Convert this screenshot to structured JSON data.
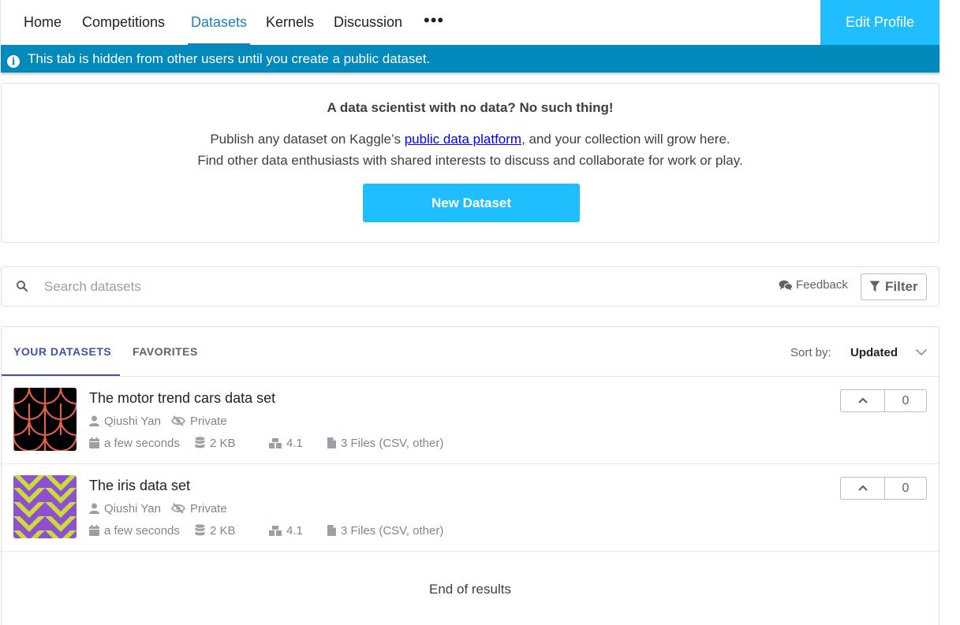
{
  "nav": {
    "tabs": [
      {
        "label": "Home"
      },
      {
        "label": "Competitions"
      },
      {
        "label": "Datasets",
        "active": true
      },
      {
        "label": "Kernels"
      },
      {
        "label": "Discussion"
      }
    ],
    "more_label": "•••",
    "edit_profile": "Edit Profile"
  },
  "banner": {
    "icon": "info-icon",
    "text": "This tab is hidden from other users until you create a public dataset."
  },
  "promo": {
    "title": "A data scientist with no data? No such thing!",
    "line1_before": "Publish any dataset on Kaggle’s ",
    "line1_link": "public data platform",
    "line1_after": ", and your collection will grow here.",
    "line2": "Find other data enthusiasts with shared interests to discuss and collaborate for work or play.",
    "button": "New Dataset"
  },
  "search": {
    "placeholder": "Search datasets",
    "value": "",
    "feedback": "Feedback",
    "filter": "Filter"
  },
  "results": {
    "tabs": {
      "yours": "YOUR DATASETS",
      "favorites": "FAVORITES"
    },
    "sort_label": "Sort by:",
    "sort_value": "Updated",
    "items": [
      {
        "title": "The motor trend cars data set",
        "owner": "Qiushi Yan",
        "visibility": "Private",
        "updated": "a few seconds",
        "size": "2 KB",
        "usability": "4.1",
        "files": "3 Files (CSV, other)",
        "votes": "0",
        "thumb": "scales-pattern"
      },
      {
        "title": "The iris data set",
        "owner": "Qiushi Yan",
        "visibility": "Private",
        "updated": "a few seconds",
        "size": "2 KB",
        "usability": "4.1",
        "files": "3 Files (CSV, other)",
        "votes": "0",
        "thumb": "chevron-pattern"
      }
    ],
    "end_text": "End of results"
  },
  "colors": {
    "accent": "#20beff",
    "banner": "#008abc",
    "active_tab": "#1f7fbf",
    "results_tab": "#3f51b5"
  }
}
